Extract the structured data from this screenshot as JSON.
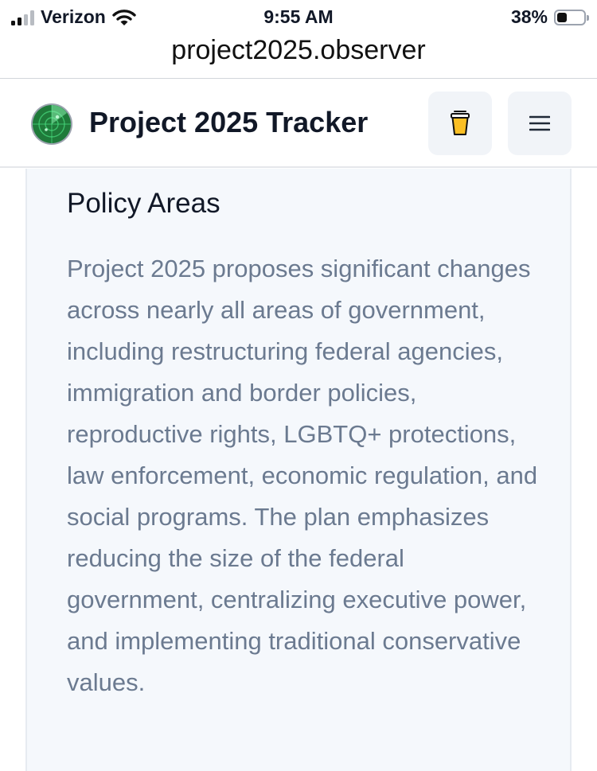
{
  "status_bar": {
    "carrier": "Verizon",
    "time": "9:55 AM",
    "battery": "38%",
    "battery_level": 0.38
  },
  "browser": {
    "url": "project2025.observer"
  },
  "header": {
    "site_title": "Project 2025 Tracker",
    "logo_icon": "radar-icon",
    "coffee_icon": "coffee-cup-icon",
    "menu_icon": "hamburger-menu-icon"
  },
  "section": {
    "title": "Policy Areas",
    "body": "Project 2025 proposes significant changes across nearly all areas of government, including restructuring federal agencies, immigration and border policies, reproductive rights, LGBTQ+ protections, law enforcement, economic regulation, and social programs. The plan emphasizes reducing the size of the federal government, centralizing executive power, and implementing traditional conservative values."
  },
  "colors": {
    "card_background": "#f5f8fc",
    "body_text": "#6b7a90",
    "button_background": "#f1f4f8",
    "logo_green": "#1f7a3a"
  }
}
